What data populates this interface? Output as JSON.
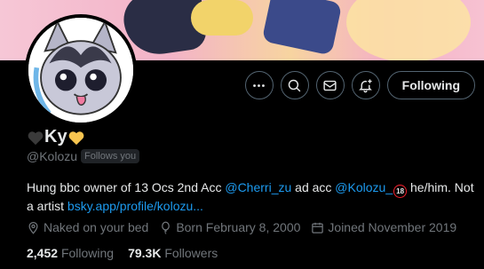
{
  "profile": {
    "display_name": "Ky",
    "handle": "@Kolozu",
    "follows_you": "Follows you",
    "bio": {
      "text1": "Hung bbc owner of 13 Ocs 2nd Acc ",
      "mention1": "@Cherri_zu",
      "text2": " ad acc ",
      "mention2": "@Kolozu_",
      "badge": "18",
      "text3": " he/him.  Not a artist ",
      "link": "bsky.app/profile/kolozu..."
    },
    "location": "Naked on your bed",
    "born": "Born February 8, 2000",
    "joined": "Joined November 2019",
    "following_count": "2,452",
    "following_label": "Following",
    "followers_count": "79.3K",
    "followers_label": "Followers"
  },
  "actions": {
    "more_icon": "more-icon",
    "grok_icon": "search-icon",
    "message_icon": "message-icon",
    "notify_icon": "bell-plus-icon",
    "follow_label": "Following"
  },
  "colors": {
    "accent": "#1d9bf0",
    "muted": "#71767b",
    "heart_left": "#3a3a3a",
    "heart_right": "#f7c550"
  }
}
